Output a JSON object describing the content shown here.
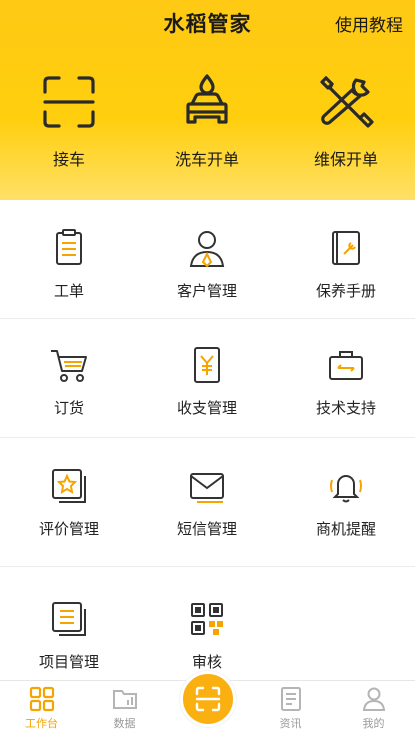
{
  "header": {
    "title": "水稻管家",
    "tutorial_label": "使用教程"
  },
  "hero_actions": [
    {
      "label": "接车",
      "icon": "scan-frame-icon"
    },
    {
      "label": "洗车开单",
      "icon": "car-wash-icon"
    },
    {
      "label": "维保开单",
      "icon": "wrench-screwdriver-icon"
    }
  ],
  "grid": [
    [
      {
        "label": "工单",
        "icon": "clipboard-icon"
      },
      {
        "label": "客户管理",
        "icon": "customer-icon"
      },
      {
        "label": "保养手册",
        "icon": "maintenance-book-icon"
      }
    ],
    [
      {
        "label": "订货",
        "icon": "shopping-cart-icon"
      },
      {
        "label": "收支管理",
        "icon": "yen-receipt-icon"
      },
      {
        "label": "技术支持",
        "icon": "toolbox-icon"
      }
    ],
    [
      {
        "label": "评价管理",
        "icon": "star-review-icon"
      },
      {
        "label": "短信管理",
        "icon": "envelope-icon"
      },
      {
        "label": "商机提醒",
        "icon": "bell-ringing-icon"
      }
    ],
    [
      {
        "label": "项目管理",
        "icon": "project-list-icon"
      },
      {
        "label": "审核",
        "icon": "qr-code-icon"
      }
    ]
  ],
  "tabbar": {
    "items": [
      {
        "label": "工作台",
        "icon": "workbench-grid-icon",
        "active": true
      },
      {
        "label": "数据",
        "icon": "data-folder-icon",
        "active": false
      },
      {
        "label": "",
        "icon": "scan-icon",
        "active": false
      },
      {
        "label": "资讯",
        "icon": "news-icon",
        "active": false
      },
      {
        "label": "我的",
        "icon": "profile-icon",
        "active": false
      }
    ]
  },
  "colors": {
    "brand_yellow": "#ffcc0f",
    "accent_orange": "#f5a400",
    "icon_dark": "#333333"
  }
}
